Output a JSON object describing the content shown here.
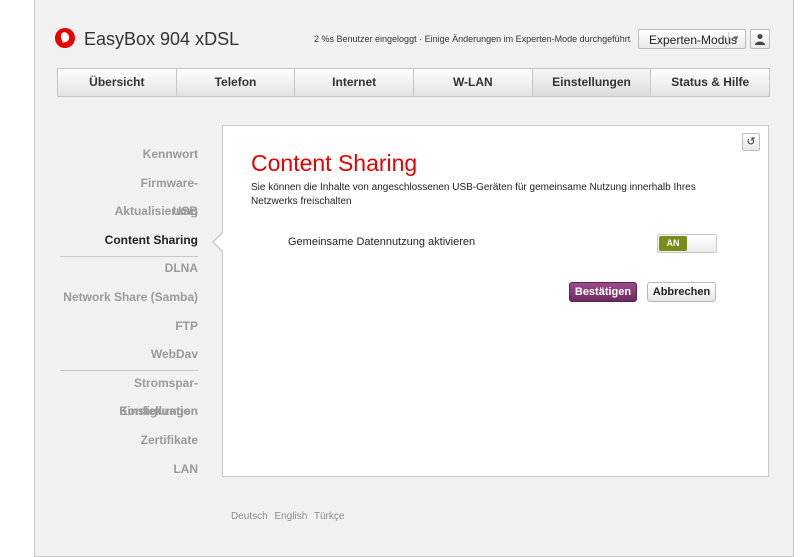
{
  "header": {
    "brand": "EasyBox 904 xDSL",
    "status_text": "2 %s Benutzer eingeloggt · Einige Änderungen im Experten-Mode durchgeführt",
    "mode_select_value": "Experten-Modus",
    "logo_icon": "vodafone-logo",
    "user_icon": "user-icon"
  },
  "nav": {
    "tabs": [
      "Übersicht",
      "Telefon",
      "Internet",
      "W-LAN",
      "Einstellungen",
      "Status & Hilfe"
    ],
    "active": "Einstellungen"
  },
  "sidebar": {
    "items": [
      {
        "label": "Kennwort"
      },
      {
        "label": "Firmware-Aktualisierung"
      },
      {
        "label": "USB"
      },
      {
        "label": "Content Sharing"
      },
      {
        "label": "DLNA"
      },
      {
        "label": "Network Share (Samba)"
      },
      {
        "label": "FTP"
      },
      {
        "label": "WebDav"
      },
      {
        "label": "Stromspar-Einstellungen"
      },
      {
        "label": "Konfiguration"
      },
      {
        "label": "Zertifikate"
      },
      {
        "label": "LAN"
      }
    ],
    "active": "Content Sharing"
  },
  "main": {
    "title": "Content Sharing",
    "description": "Sie können die Inhalte von angeschlossenen USB-Geräten für gemeinsame Nutzung innerhalb Ihres Netzwerks freischalten",
    "setting_label": "Gemeinsame Datennutzung aktivieren",
    "toggle_label": "AN",
    "confirm_label": "Bestätigen",
    "cancel_label": "Abbrechen",
    "refresh_icon": "refresh-icon"
  },
  "footer": {
    "languages": [
      "Deutsch",
      "English",
      "Türkçe"
    ]
  },
  "colors": {
    "brand_red": "#e60000",
    "confirm_purple": "#7e3570",
    "toggle_green": "#7a8c1a"
  }
}
